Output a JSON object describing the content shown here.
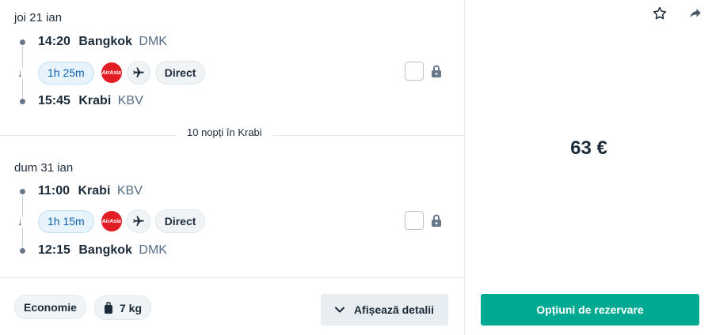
{
  "outbound": {
    "date": "joi 21 ian",
    "departure": {
      "time": "14:20",
      "city": "Bangkok",
      "code": "DMK"
    },
    "duration": "1h 25m",
    "airline": "AirAsia",
    "type": "Direct",
    "arrival": {
      "time": "15:45",
      "city": "Krabi",
      "code": "KBV"
    }
  },
  "stay": {
    "text": "10 nopți în Krabi"
  },
  "inbound": {
    "date": "dum 31 ian",
    "departure": {
      "time": "11:00",
      "city": "Krabi",
      "code": "KBV"
    },
    "duration": "1h 15m",
    "airline": "AirAsia",
    "type": "Direct",
    "arrival": {
      "time": "12:15",
      "city": "Bangkok",
      "code": "DMK"
    }
  },
  "footer": {
    "cabin_class": "Economie",
    "baggage": "7 kg",
    "details_label": "Afișează detalii"
  },
  "summary": {
    "price": "63 €",
    "book_label": "Opțiuni de rezervare"
  },
  "icons": {
    "favorite": "star-outline-icon",
    "share": "share-arrow-icon",
    "plane": "plane-icon",
    "lock": "lock-icon",
    "bag": "bag-icon",
    "chevron": "chevron-down-icon"
  },
  "colors": {
    "accent": "#00a991",
    "duration_bg": "#e8f4fd",
    "duration_text": "#0a5fa8",
    "airline_red": "#e31d24"
  }
}
